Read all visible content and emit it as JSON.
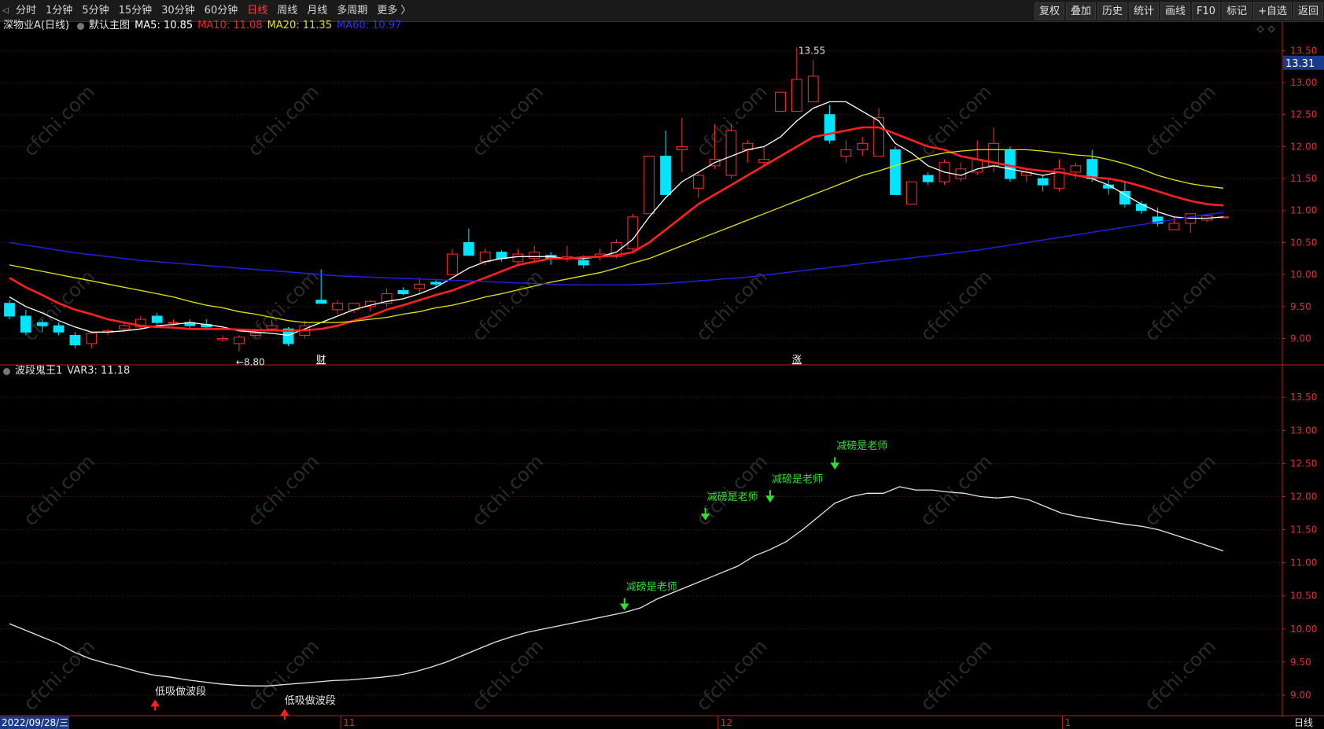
{
  "toolbar": {
    "left_items": [
      "分时",
      "1分钟",
      "5分钟",
      "15分钟",
      "30分钟",
      "60分钟",
      "日线",
      "周线",
      "月线",
      "多周期",
      "更多 〉"
    ],
    "active": "日线",
    "right_items": [
      "复权",
      "叠加",
      "历史",
      "统计",
      "画线",
      "F10",
      "标记",
      "+自选",
      "返回"
    ]
  },
  "main_panel": {
    "stock_name": "深物业A(日线)",
    "template": "默认主图",
    "ma_labels": [
      {
        "text": "MA5: 10.85",
        "color": "#ffffff"
      },
      {
        "text": "MA10: 11.08",
        "color": "#ff2020"
      },
      {
        "text": "MA20: 11.35",
        "color": "#e6e600"
      },
      {
        "text": "MA60: 10.97",
        "color": "#3030ff"
      }
    ],
    "current_price": "13.31",
    "high_label": "13.55",
    "low_label": "←8.80",
    "markers": [
      {
        "text": "财"
      },
      {
        "text": "涨"
      }
    ]
  },
  "indicator_panel": {
    "title": "波段鬼王1",
    "value_label": "VAR3: 11.18",
    "sell_text": "减磅是老师",
    "buy_text": "低吸做波段"
  },
  "date_axis": {
    "start": "2022/09/28/三",
    "month_labels": [
      "11",
      "12",
      "1"
    ],
    "period": "日线"
  },
  "watermark": "cfchi.com",
  "colors": {
    "up": "#ff3030",
    "down": "#00e5ff",
    "ma5": "#ffffff",
    "ma10": "#ff2020",
    "ma20": "#e6e600",
    "ma60": "#2020e0",
    "axis": "#c02020",
    "signal": "#33dd33"
  },
  "chart_data": [
    {
      "type": "candlestick",
      "title": "深物业A(日线)",
      "y_ticks": [
        9.0,
        9.5,
        10.0,
        10.5,
        11.0,
        11.5,
        12.0,
        12.5,
        13.0,
        13.5
      ],
      "ylim": [
        8.6,
        13.75
      ],
      "candles": [
        [
          9.55,
          9.6,
          9.3,
          9.35
        ],
        [
          9.35,
          9.45,
          9.05,
          9.1
        ],
        [
          9.25,
          9.3,
          9.1,
          9.2
        ],
        [
          9.2,
          9.25,
          9.05,
          9.1
        ],
        [
          9.05,
          9.1,
          8.85,
          8.9
        ],
        [
          8.92,
          9.1,
          8.85,
          9.08
        ],
        [
          9.1,
          9.15,
          9.05,
          9.12
        ],
        [
          9.15,
          9.25,
          9.1,
          9.2
        ],
        [
          9.18,
          9.35,
          9.15,
          9.3
        ],
        [
          9.35,
          9.4,
          9.22,
          9.25
        ],
        [
          9.25,
          9.3,
          9.2,
          9.25
        ],
        [
          9.25,
          9.3,
          9.15,
          9.2
        ],
        [
          9.22,
          9.3,
          9.15,
          9.18
        ],
        [
          8.98,
          9.05,
          8.95,
          9.0
        ],
        [
          8.92,
          9.05,
          8.8,
          9.02
        ],
        [
          9.05,
          9.12,
          9.02,
          9.08
        ],
        [
          9.15,
          9.3,
          9.12,
          9.2
        ],
        [
          9.15,
          9.18,
          8.88,
          8.92
        ],
        [
          9.05,
          9.28,
          9.0,
          9.2
        ],
        [
          9.6,
          10.08,
          9.55,
          9.55
        ],
        [
          9.45,
          9.6,
          9.38,
          9.55
        ],
        [
          9.45,
          9.55,
          9.4,
          9.55
        ],
        [
          9.5,
          9.6,
          9.42,
          9.58
        ],
        [
          9.55,
          9.78,
          9.5,
          9.7
        ],
        [
          9.75,
          9.8,
          9.68,
          9.7
        ],
        [
          9.78,
          9.95,
          9.7,
          9.85
        ],
        [
          9.88,
          9.92,
          9.8,
          9.85
        ],
        [
          10.0,
          10.4,
          10.0,
          10.32
        ],
        [
          10.5,
          10.72,
          10.3,
          10.3
        ],
        [
          10.2,
          10.4,
          10.15,
          10.35
        ],
        [
          10.35,
          10.38,
          10.2,
          10.25
        ],
        [
          10.2,
          10.4,
          10.15,
          10.32
        ],
        [
          10.25,
          10.45,
          10.2,
          10.35
        ],
        [
          10.3,
          10.35,
          10.15,
          10.25
        ],
        [
          10.25,
          10.45,
          10.2,
          10.28
        ],
        [
          10.22,
          10.3,
          10.1,
          10.15
        ],
        [
          10.28,
          10.4,
          10.22,
          10.32
        ],
        [
          10.28,
          10.55,
          10.25,
          10.5
        ],
        [
          10.4,
          10.95,
          10.35,
          10.9
        ],
        [
          10.95,
          11.85,
          10.95,
          11.85
        ],
        [
          11.85,
          12.25,
          11.25,
          11.25
        ],
        [
          11.95,
          12.45,
          11.6,
          12.0
        ],
        [
          11.35,
          11.6,
          11.2,
          11.55
        ],
        [
          11.7,
          12.35,
          11.65,
          11.8
        ],
        [
          11.55,
          12.35,
          11.5,
          12.25
        ],
        [
          11.95,
          12.1,
          11.75,
          12.05
        ],
        [
          11.75,
          12.0,
          11.7,
          11.8
        ],
        [
          12.55,
          12.85,
          12.55,
          12.85
        ],
        [
          12.55,
          13.55,
          12.55,
          13.05
        ],
        [
          12.7,
          13.35,
          12.7,
          13.1
        ],
        [
          12.5,
          12.65,
          12.05,
          12.1
        ],
        [
          11.85,
          12.1,
          11.75,
          11.95
        ],
        [
          11.95,
          12.15,
          11.85,
          12.05
        ],
        [
          11.85,
          12.6,
          11.85,
          12.45
        ],
        [
          11.95,
          12.0,
          11.25,
          11.25
        ],
        [
          11.1,
          11.45,
          11.1,
          11.45
        ],
        [
          11.55,
          11.6,
          11.4,
          11.45
        ],
        [
          11.45,
          11.8,
          11.4,
          11.75
        ],
        [
          11.5,
          11.75,
          11.45,
          11.65
        ],
        [
          11.6,
          12.1,
          11.55,
          11.8
        ],
        [
          11.7,
          12.3,
          11.6,
          12.05
        ],
        [
          11.95,
          12.0,
          11.45,
          11.5
        ],
        [
          11.55,
          11.65,
          11.45,
          11.6
        ],
        [
          11.5,
          11.55,
          11.3,
          11.4
        ],
        [
          11.35,
          11.8,
          11.3,
          11.65
        ],
        [
          11.6,
          11.75,
          11.5,
          11.7
        ],
        [
          11.8,
          11.95,
          11.45,
          11.5
        ],
        [
          11.4,
          11.5,
          11.25,
          11.35
        ],
        [
          11.3,
          11.45,
          11.05,
          11.1
        ],
        [
          11.1,
          11.15,
          10.95,
          11.0
        ],
        [
          10.9,
          11.05,
          10.75,
          10.8
        ],
        [
          10.7,
          10.9,
          10.7,
          10.8
        ],
        [
          10.8,
          10.95,
          10.65,
          10.95
        ],
        [
          10.85,
          10.95,
          10.82,
          10.92
        ],
        [
          10.9,
          10.92,
          10.88,
          10.9
        ]
      ],
      "series": [
        {
          "name": "MA5",
          "values": [
            9.65,
            9.5,
            9.4,
            9.28,
            9.18,
            9.1,
            9.1,
            9.12,
            9.15,
            9.2,
            9.22,
            9.25,
            9.22,
            9.18,
            9.12,
            9.1,
            9.08,
            9.05,
            9.15,
            9.25,
            9.35,
            9.45,
            9.52,
            9.58,
            9.62,
            9.7,
            9.8,
            9.95,
            10.1,
            10.2,
            10.25,
            10.28,
            10.28,
            10.28,
            10.25,
            10.25,
            10.28,
            10.35,
            10.55,
            10.9,
            11.2,
            11.45,
            11.6,
            11.75,
            11.85,
            11.95,
            12.0,
            12.15,
            12.4,
            12.6,
            12.7,
            12.7,
            12.55,
            12.4,
            12.05,
            11.9,
            11.7,
            11.6,
            11.55,
            11.65,
            11.7,
            11.65,
            11.6,
            11.55,
            11.6,
            11.55,
            11.5,
            11.4,
            11.25,
            11.1,
            10.98,
            10.9,
            10.88,
            10.88,
            10.9
          ]
        },
        {
          "name": "MA10",
          "values": [
            9.95,
            9.8,
            9.68,
            9.55,
            9.45,
            9.38,
            9.3,
            9.25,
            9.2,
            9.18,
            9.17,
            9.15,
            9.15,
            9.15,
            9.14,
            9.13,
            9.13,
            9.12,
            9.13,
            9.15,
            9.2,
            9.28,
            9.35,
            9.45,
            9.52,
            9.6,
            9.68,
            9.75,
            9.85,
            9.95,
            10.05,
            10.15,
            10.2,
            10.25,
            10.25,
            10.27,
            10.28,
            10.3,
            10.35,
            10.5,
            10.7,
            10.9,
            11.1,
            11.25,
            11.4,
            11.55,
            11.7,
            11.85,
            12.0,
            12.15,
            12.2,
            12.25,
            12.3,
            12.3,
            12.2,
            12.1,
            12.0,
            11.95,
            11.85,
            11.8,
            11.75,
            11.7,
            11.65,
            11.62,
            11.6,
            11.55,
            11.52,
            11.5,
            11.45,
            11.38,
            11.3,
            11.22,
            11.15,
            11.1,
            11.08
          ]
        },
        {
          "name": "MA20",
          "values": [
            10.15,
            10.1,
            10.05,
            10.0,
            9.95,
            9.9,
            9.85,
            9.8,
            9.75,
            9.7,
            9.65,
            9.58,
            9.52,
            9.48,
            9.42,
            9.38,
            9.33,
            9.28,
            9.25,
            9.25,
            9.25,
            9.27,
            9.3,
            9.33,
            9.38,
            9.42,
            9.48,
            9.52,
            9.58,
            9.65,
            9.7,
            9.76,
            9.82,
            9.88,
            9.93,
            9.98,
            10.03,
            10.1,
            10.18,
            10.25,
            10.35,
            10.45,
            10.55,
            10.65,
            10.75,
            10.85,
            10.95,
            11.05,
            11.15,
            11.25,
            11.35,
            11.45,
            11.55,
            11.62,
            11.7,
            11.78,
            11.85,
            11.9,
            11.93,
            11.95,
            11.95,
            11.95,
            11.95,
            11.93,
            11.9,
            11.87,
            11.85,
            11.8,
            11.73,
            11.65,
            11.55,
            11.48,
            11.42,
            11.38,
            11.35
          ]
        },
        {
          "name": "MA60",
          "values": [
            10.5,
            10.46,
            10.42,
            10.38,
            10.34,
            10.31,
            10.28,
            10.25,
            10.22,
            10.2,
            10.18,
            10.16,
            10.14,
            10.12,
            10.1,
            10.08,
            10.06,
            10.04,
            10.02,
            10.0,
            9.98,
            9.97,
            9.96,
            9.95,
            9.94,
            9.93,
            9.92,
            9.91,
            9.9,
            9.89,
            9.88,
            9.87,
            9.86,
            9.85,
            9.84,
            9.84,
            9.84,
            9.84,
            9.84,
            9.85,
            9.86,
            9.88,
            9.9,
            9.92,
            9.94,
            9.96,
            9.99,
            10.02,
            10.05,
            10.08,
            10.11,
            10.14,
            10.17,
            10.2,
            10.23,
            10.26,
            10.29,
            10.32,
            10.35,
            10.38,
            10.42,
            10.46,
            10.5,
            10.54,
            10.58,
            10.62,
            10.66,
            10.7,
            10.74,
            10.78,
            10.82,
            10.86,
            10.9,
            10.94,
            10.97
          ]
        }
      ]
    },
    {
      "type": "line",
      "title": "波段鬼王1",
      "y_ticks": [
        9.0,
        9.5,
        10.0,
        10.5,
        11.0,
        11.5,
        12.0,
        12.5,
        13.0,
        13.5
      ],
      "ylim": [
        8.75,
        13.8
      ],
      "series": [
        {
          "name": "VAR3",
          "values": [
            10.08,
            9.98,
            9.88,
            9.78,
            9.65,
            9.55,
            9.48,
            9.42,
            9.35,
            9.3,
            9.27,
            9.23,
            9.2,
            9.17,
            9.15,
            9.14,
            9.14,
            9.16,
            9.18,
            9.2,
            9.22,
            9.23,
            9.25,
            9.27,
            9.3,
            9.35,
            9.42,
            9.5,
            9.6,
            9.7,
            9.8,
            9.88,
            9.95,
            10.0,
            10.05,
            10.1,
            10.15,
            10.2,
            10.25,
            10.32,
            10.45,
            10.55,
            10.65,
            10.75,
            10.85,
            10.95,
            11.1,
            11.2,
            11.32,
            11.5,
            11.7,
            11.9,
            12.0,
            12.05,
            12.05,
            12.15,
            12.1,
            12.1,
            12.07,
            12.05,
            12.0,
            11.98,
            12.0,
            11.95,
            11.85,
            11.75,
            11.7,
            11.66,
            11.62,
            11.58,
            11.55,
            11.5,
            11.42,
            11.34,
            11.26,
            11.18
          ]
        }
      ]
    }
  ]
}
